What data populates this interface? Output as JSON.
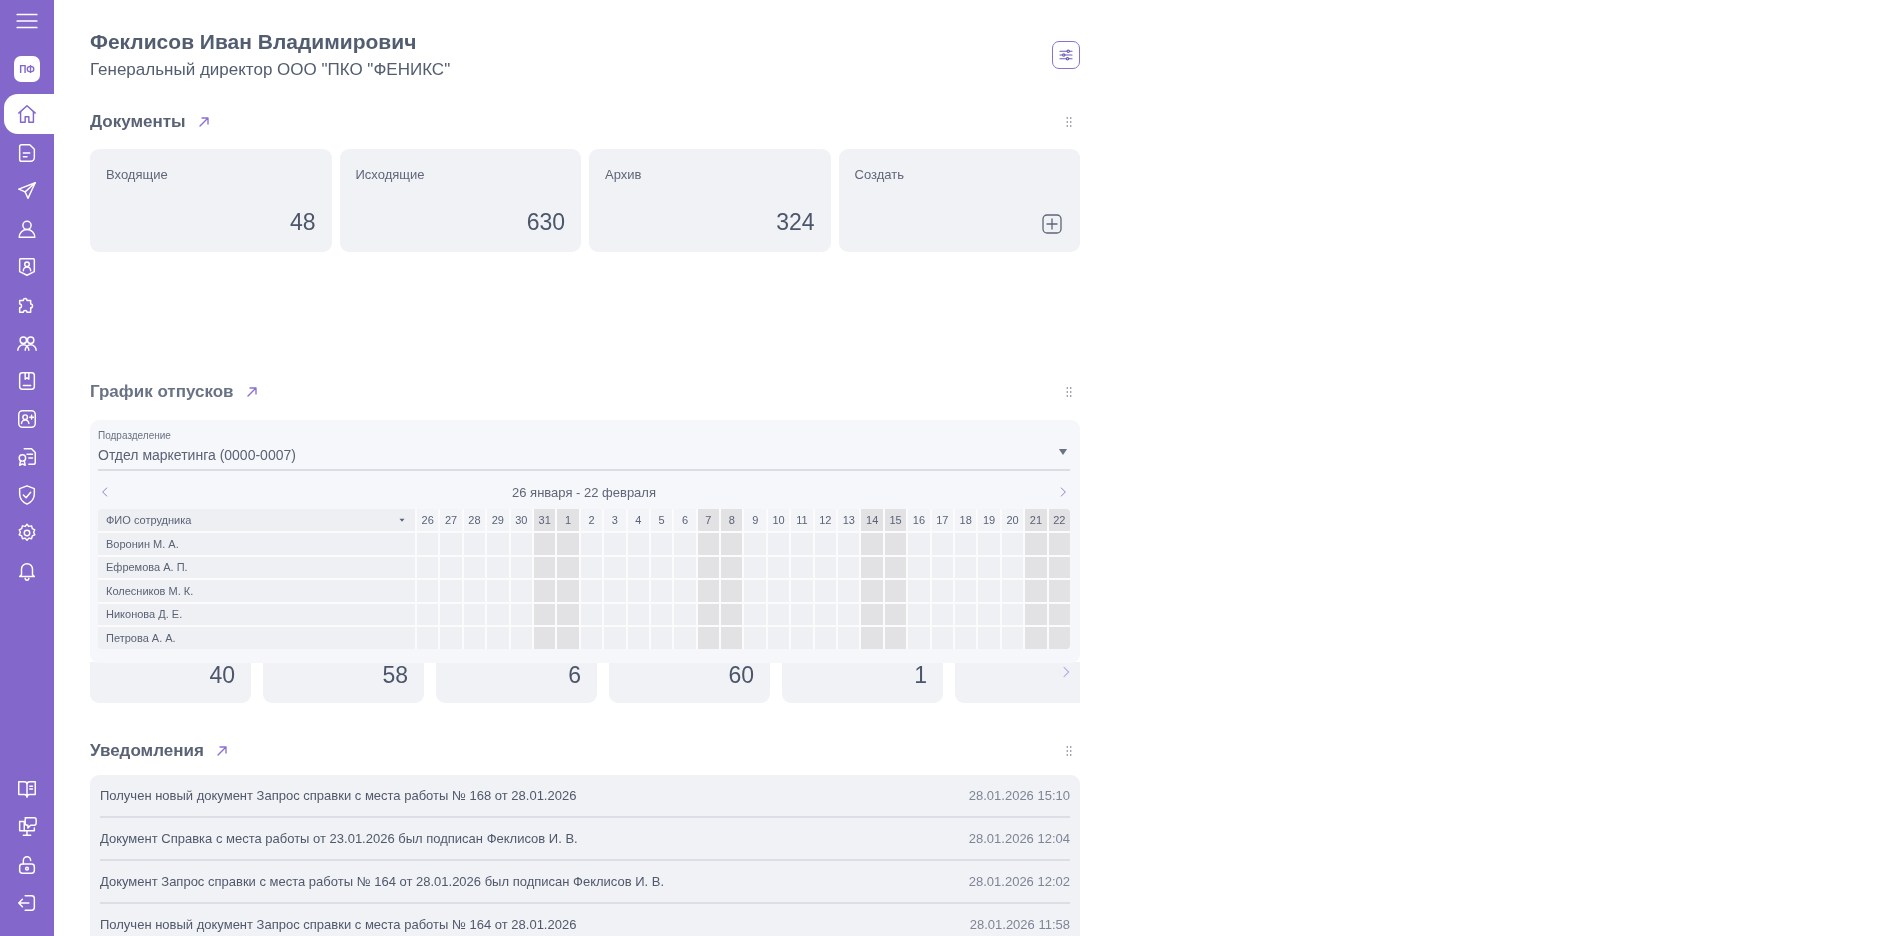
{
  "sidebar": {
    "logo": "ПФ",
    "items": [
      {
        "kind": "home",
        "selected": true
      },
      {
        "kind": "document",
        "selected": false
      },
      {
        "kind": "send",
        "selected": false
      },
      {
        "kind": "user",
        "selected": false
      },
      {
        "kind": "badge",
        "selected": false
      },
      {
        "kind": "puzzle",
        "selected": false
      },
      {
        "kind": "group",
        "selected": false
      },
      {
        "kind": "bookmark",
        "selected": false
      },
      {
        "kind": "adduser",
        "selected": false
      },
      {
        "kind": "certificate",
        "selected": false
      },
      {
        "kind": "shield",
        "selected": false
      },
      {
        "kind": "settings",
        "selected": false
      },
      {
        "kind": "bell",
        "selected": false
      }
    ],
    "bottom_items": [
      {
        "kind": "book"
      },
      {
        "kind": "support"
      },
      {
        "kind": "unlock"
      },
      {
        "kind": "logout"
      }
    ]
  },
  "profile": {
    "name": "Феклисов Иван Владимирович",
    "position": "Генеральный директор ООО \"ПКО \"ФЕНИКС\""
  },
  "documents": {
    "title": "Документы",
    "cards": [
      {
        "kind": "count",
        "label": "Входящие",
        "value": "48"
      },
      {
        "kind": "count",
        "label": "Исходящие",
        "value": "630"
      },
      {
        "kind": "count",
        "label": "Архив",
        "value": "324"
      },
      {
        "kind": "create",
        "label": "Создать"
      }
    ]
  },
  "vacation_schedule": {
    "title": "График отпусков",
    "department": {
      "label": "Подразделение",
      "value": "Отдел маркетинга (0000-0007)"
    },
    "period": "26 января - 22 февраля",
    "name_column": "ФИО сотрудника",
    "days": [
      {
        "day": "26",
        "weekend": false
      },
      {
        "day": "27",
        "weekend": false
      },
      {
        "day": "28",
        "weekend": false
      },
      {
        "day": "29",
        "weekend": false
      },
      {
        "day": "30",
        "weekend": false
      },
      {
        "day": "31",
        "weekend": true
      },
      {
        "day": "1",
        "weekend": true
      },
      {
        "day": "2",
        "weekend": false
      },
      {
        "day": "3",
        "weekend": false
      },
      {
        "day": "4",
        "weekend": false
      },
      {
        "day": "5",
        "weekend": false
      },
      {
        "day": "6",
        "weekend": false
      },
      {
        "day": "7",
        "weekend": true
      },
      {
        "day": "8",
        "weekend": true
      },
      {
        "day": "9",
        "weekend": false
      },
      {
        "day": "10",
        "weekend": false
      },
      {
        "day": "11",
        "weekend": false
      },
      {
        "day": "12",
        "weekend": false
      },
      {
        "day": "13",
        "weekend": false
      },
      {
        "day": "14",
        "weekend": true
      },
      {
        "day": "15",
        "weekend": true
      },
      {
        "day": "16",
        "weekend": false
      },
      {
        "day": "17",
        "weekend": false
      },
      {
        "day": "18",
        "weekend": false
      },
      {
        "day": "19",
        "weekend": false
      },
      {
        "day": "20",
        "weekend": false
      },
      {
        "day": "21",
        "weekend": true
      },
      {
        "day": "22",
        "weekend": true
      }
    ],
    "employees": [
      "Воронин М. А.",
      "Ефремова А. П.",
      "Колесников М. К.",
      "Никонова Д. Е.",
      "Петрова А. А."
    ]
  },
  "users": {
    "cards": [
      {
        "kind": "count",
        "value": "40"
      },
      {
        "kind": "count",
        "value": "58"
      },
      {
        "kind": "count",
        "value": "6"
      },
      {
        "kind": "count",
        "value": "60"
      },
      {
        "kind": "count",
        "value": "1"
      },
      {
        "kind": "blank"
      }
    ]
  },
  "notifications": {
    "title": "Уведомления",
    "items": [
      {
        "text": "Получен новый документ Запрос справки с места работы № 168 от 28.01.2026",
        "time": "28.01.2026 15:10"
      },
      {
        "text": "Документ Справка с места работы от 23.01.2026 был подписан Феклисов И. В.",
        "time": "28.01.2026 12:04"
      },
      {
        "text": "Документ Запрос справки с места работы № 164 от 28.01.2026 был подписан Феклисов И. В.",
        "time": "28.01.2026 12:02"
      },
      {
        "text": "Получен новый документ Запрос справки с места работы № 164 от 28.01.2026",
        "time": "28.01.2026 11:58"
      }
    ]
  }
}
